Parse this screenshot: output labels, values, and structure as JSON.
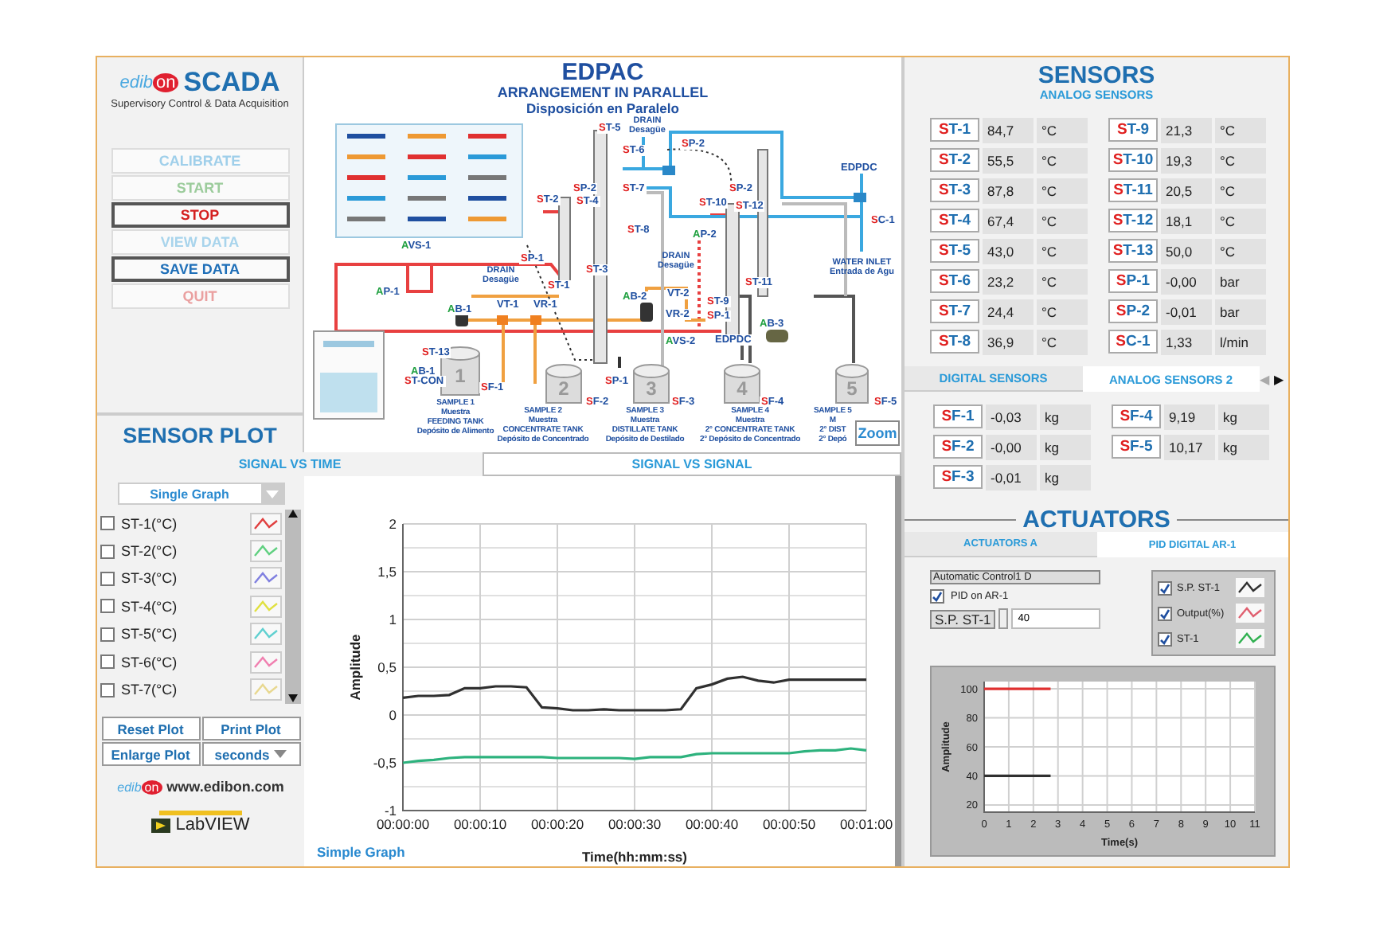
{
  "header": {
    "brand": "edibon",
    "product": "SCADA",
    "tagline": "Supervisory Control & Data Acquisition"
  },
  "control_buttons": [
    {
      "label": "CALIBRATE",
      "disabled": true,
      "color": "#9fcfea"
    },
    {
      "label": "START",
      "disabled": true,
      "color": "#9ccc9c"
    },
    {
      "label": "STOP",
      "disabled": false,
      "color": "#d42020"
    },
    {
      "label": "VIEW DATA",
      "disabled": true,
      "color": "#a8d4ec"
    },
    {
      "label": "SAVE DATA",
      "disabled": false,
      "color": "#1f6fb8"
    },
    {
      "label": "QUIT",
      "disabled": true,
      "color": "#eaa0a0"
    }
  ],
  "diagram": {
    "title": "EDPAC",
    "subtitle": "ARRANGEMENT IN PARALLEL",
    "subtitle_es": "Disposición en Paralelo",
    "tags": [
      {
        "text": "ST-5",
        "kind": "sensor"
      },
      {
        "text": "ST-6",
        "kind": "sensor"
      },
      {
        "text": "SP-2",
        "kind": "sensor"
      },
      {
        "text": "SP-2",
        "kind": "sensor"
      },
      {
        "text": "ST-7",
        "kind": "sensor"
      },
      {
        "text": "ST-2",
        "kind": "sensor"
      },
      {
        "text": "ST-4",
        "kind": "sensor"
      },
      {
        "text": "SP-2",
        "kind": "sensor"
      },
      {
        "text": "ST-10",
        "kind": "sensor"
      },
      {
        "text": "ST-12",
        "kind": "sensor"
      },
      {
        "text": "EDPDC",
        "kind": "label"
      },
      {
        "text": "SC-1",
        "kind": "sensor"
      },
      {
        "text": "ST-8",
        "kind": "sensor"
      },
      {
        "text": "AP-2",
        "kind": "actuator"
      },
      {
        "text": "AVS-1",
        "kind": "actuator"
      },
      {
        "text": "SP-1",
        "kind": "sensor"
      },
      {
        "text": "ST-3",
        "kind": "sensor"
      },
      {
        "text": "ST-11",
        "kind": "sensor"
      },
      {
        "text": "AP-1",
        "kind": "actuator"
      },
      {
        "text": "ST-1",
        "kind": "sensor"
      },
      {
        "text": "AB-2",
        "kind": "actuator"
      },
      {
        "text": "VT-2",
        "kind": "label"
      },
      {
        "text": "VT-1",
        "kind": "label"
      },
      {
        "text": "VR-1",
        "kind": "label"
      },
      {
        "text": "ST-9",
        "kind": "sensor"
      },
      {
        "text": "AB-1",
        "kind": "actuator"
      },
      {
        "text": "VR-2",
        "kind": "label"
      },
      {
        "text": "SP-1",
        "kind": "sensor"
      },
      {
        "text": "AB-3",
        "kind": "actuator"
      },
      {
        "text": "AVS-2",
        "kind": "actuator"
      },
      {
        "text": "EDPDC",
        "kind": "label"
      },
      {
        "text": "ST-13",
        "kind": "sensor"
      },
      {
        "text": "AB-1",
        "kind": "actuator"
      },
      {
        "text": "ST-CON",
        "kind": "sensor"
      },
      {
        "text": "SF-1",
        "kind": "sensor"
      },
      {
        "text": "SP-1",
        "kind": "sensor"
      },
      {
        "text": "SF-2",
        "kind": "sensor"
      },
      {
        "text": "SF-3",
        "kind": "sensor"
      },
      {
        "text": "SF-4",
        "kind": "sensor"
      },
      {
        "text": "SF-5",
        "kind": "sensor"
      }
    ],
    "notes": [
      {
        "lines": [
          "DRAIN",
          "Desagüe"
        ]
      },
      {
        "lines": [
          "DRAIN",
          "Desagüe"
        ]
      },
      {
        "lines": [
          "DRAIN",
          "Desagüe"
        ]
      },
      {
        "lines": [
          "WATER INLET",
          "Entrada de Agu"
        ]
      }
    ],
    "tanks": [
      {
        "number": "1",
        "caption": [
          "SAMPLE 1",
          "Muestra",
          "FEEDING TANK",
          "Depósito de Alimento"
        ]
      },
      {
        "number": "2",
        "caption": [
          "SAMPLE 2",
          "Muestra",
          "CONCENTRATE TANK",
          "Depósito de Concentrado"
        ]
      },
      {
        "number": "3",
        "caption": [
          "SAMPLE 3",
          "Muestra",
          "DISTILLATE TANK",
          "Depósito de Destilado"
        ]
      },
      {
        "number": "4",
        "caption": [
          "SAMPLE 4",
          "Muestra",
          "2° CONCENTRATE TANK",
          "2° Depósito de Concentrado"
        ]
      },
      {
        "number": "5",
        "caption": [
          "SAMPLE 5",
          "M",
          "2° DIST",
          "2° Depó"
        ]
      }
    ],
    "zoom_button": "Zoom"
  },
  "sensor_plot": {
    "title": "SENSOR PLOT",
    "tabs": [
      {
        "label": "SIGNAL VS TIME",
        "selected": true
      },
      {
        "label": "SIGNAL VS SIGNAL",
        "selected": false
      }
    ],
    "graph_mode": "Single Graph",
    "signals": [
      {
        "label": "ST-1(°C)",
        "checked": false,
        "color": "#e04040"
      },
      {
        "label": "ST-2(°C)",
        "checked": false,
        "color": "#60d080"
      },
      {
        "label": "ST-3(°C)",
        "checked": false,
        "color": "#8080e0"
      },
      {
        "label": "ST-4(°C)",
        "checked": false,
        "color": "#e0e040"
      },
      {
        "label": "ST-5(°C)",
        "checked": false,
        "color": "#60d0d0"
      },
      {
        "label": "ST-6(°C)",
        "checked": false,
        "color": "#f080b0"
      },
      {
        "label": "ST-7(°C)",
        "checked": false,
        "color": "#e8d890"
      }
    ],
    "buttons": [
      "Reset Plot",
      "Print Plot",
      "Enlarge Plot"
    ],
    "time_unit": "seconds",
    "graph_caption": "Simple Graph",
    "chart_data": {
      "type": "line",
      "grid": true,
      "xlabel": "Time(hh:mm:ss)",
      "ylabel": "Amplitude",
      "xlim": [
        0,
        60
      ],
      "ylim": [
        -1,
        2
      ],
      "xticks": [
        {
          "value": 0,
          "label": "00:00:00"
        },
        {
          "value": 10,
          "label": "00:00:10"
        },
        {
          "value": 20,
          "label": "00:00:20"
        },
        {
          "value": 30,
          "label": "00:00:30"
        },
        {
          "value": 40,
          "label": "00:00:40"
        },
        {
          "value": 50,
          "label": "00:00:50"
        },
        {
          "value": 60,
          "label": "00:01:00"
        }
      ],
      "yticks": [
        {
          "value": 2,
          "label": "2"
        },
        {
          "value": 1.5,
          "label": "1,5"
        },
        {
          "value": 1,
          "label": "1"
        },
        {
          "value": 0.5,
          "label": "0,5"
        },
        {
          "value": 0,
          "label": "0"
        },
        {
          "value": -0.5,
          "label": "-0,5"
        },
        {
          "value": -1,
          "label": "-1"
        }
      ],
      "x": [
        0,
        2,
        4,
        6,
        8,
        10,
        12,
        14,
        16,
        18,
        20,
        22,
        24,
        26,
        28,
        30,
        32,
        34,
        36,
        38,
        40,
        42,
        44,
        46,
        48,
        50,
        52,
        54,
        56,
        58,
        60
      ],
      "series": [
        {
          "color": "#303030",
          "values": [
            0.18,
            0.2,
            0.2,
            0.21,
            0.28,
            0.28,
            0.3,
            0.3,
            0.29,
            0.08,
            0.07,
            0.05,
            0.05,
            0.06,
            0.05,
            0.05,
            0.05,
            0.05,
            0.06,
            0.28,
            0.32,
            0.38,
            0.4,
            0.36,
            0.34,
            0.37,
            0.37,
            0.37,
            0.37,
            0.37,
            0.37
          ]
        },
        {
          "color": "#2db27d",
          "values": [
            -0.5,
            -0.48,
            -0.47,
            -0.45,
            -0.44,
            -0.44,
            -0.44,
            -0.44,
            -0.44,
            -0.44,
            -0.45,
            -0.45,
            -0.45,
            -0.45,
            -0.45,
            -0.46,
            -0.44,
            -0.44,
            -0.44,
            -0.41,
            -0.4,
            -0.4,
            -0.4,
            -0.4,
            -0.4,
            -0.4,
            -0.38,
            -0.37,
            -0.37,
            -0.35,
            -0.37
          ]
        }
      ]
    }
  },
  "footer": {
    "brand": "edibon",
    "url": "www.edibon.com",
    "labview": "LabVIEW"
  },
  "sensors": {
    "title": "SENSORS",
    "subtitle": "ANALOG SENSORS",
    "analog": [
      {
        "tag": "ST-1",
        "value": "84,7",
        "unit": "°C"
      },
      {
        "tag": "ST-2",
        "value": "55,5",
        "unit": "°C"
      },
      {
        "tag": "ST-3",
        "value": "87,8",
        "unit": "°C"
      },
      {
        "tag": "ST-4",
        "value": "67,4",
        "unit": "°C"
      },
      {
        "tag": "ST-5",
        "value": "43,0",
        "unit": "°C"
      },
      {
        "tag": "ST-6",
        "value": "23,2",
        "unit": "°C"
      },
      {
        "tag": "ST-7",
        "value": "24,4",
        "unit": "°C"
      },
      {
        "tag": "ST-8",
        "value": "36,9",
        "unit": "°C"
      },
      {
        "tag": "ST-9",
        "value": "21,3",
        "unit": "°C"
      },
      {
        "tag": "ST-10",
        "value": "19,3",
        "unit": "°C"
      },
      {
        "tag": "ST-11",
        "value": "20,5",
        "unit": "°C"
      },
      {
        "tag": "ST-12",
        "value": "18,1",
        "unit": "°C"
      },
      {
        "tag": "ST-13",
        "value": "50,0",
        "unit": "°C"
      },
      {
        "tag": "SP-1",
        "value": "-0,00",
        "unit": "bar"
      },
      {
        "tag": "SP-2",
        "value": "-0,01",
        "unit": "bar"
      },
      {
        "tag": "SC-1",
        "value": "1,33",
        "unit": "l/min"
      }
    ],
    "tabs": [
      {
        "label": "DIGITAL SENSORS",
        "selected": false
      },
      {
        "label": "ANALOG SENSORS 2",
        "selected": true
      }
    ],
    "tab_arrows": [
      {
        "glyph": "◀",
        "disabled": true
      },
      {
        "glyph": "▶",
        "disabled": false
      }
    ],
    "analog_2": [
      {
        "tag": "SF-1",
        "value": "-0,03",
        "unit": "kg"
      },
      {
        "tag": "SF-2",
        "value": "-0,00",
        "unit": "kg"
      },
      {
        "tag": "SF-3",
        "value": "-0,01",
        "unit": "kg"
      },
      {
        "tag": "SF-4",
        "value": "9,19",
        "unit": "kg"
      },
      {
        "tag": "SF-5",
        "value": "10,17",
        "unit": "kg"
      }
    ]
  },
  "actuators": {
    "title": "ACTUATORS",
    "tabs": [
      {
        "label": "ACTUATORS A",
        "selected": false
      },
      {
        "label": "PID DIGITAL AR-1",
        "selected": true
      }
    ],
    "control_group": "Automatic Control1 D",
    "pid_checkbox": {
      "label": "PID on AR-1",
      "checked": true
    },
    "setpoint": {
      "label": "S.P. ST-1",
      "value": "40"
    },
    "legend": [
      {
        "label": "S.P. ST-1",
        "checked": true,
        "color": "#303030"
      },
      {
        "label": "Output(%)",
        "checked": true,
        "color": "#e06070"
      },
      {
        "label": "ST-1",
        "checked": true,
        "color": "#30b050"
      }
    ],
    "chart_data": {
      "type": "line",
      "grid": true,
      "xlabel": "Time(s)",
      "ylabel": "Amplitude",
      "xlim": [
        0,
        11
      ],
      "ylim": [
        15,
        105
      ],
      "xticks": [
        {
          "value": 0,
          "label": "0"
        },
        {
          "value": 1,
          "label": "1"
        },
        {
          "value": 2,
          "label": "2"
        },
        {
          "value": 3,
          "label": "3"
        },
        {
          "value": 4,
          "label": "4"
        },
        {
          "value": 5,
          "label": "5"
        },
        {
          "value": 6,
          "label": "6"
        },
        {
          "value": 7,
          "label": "7"
        },
        {
          "value": 8,
          "label": "8"
        },
        {
          "value": 9,
          "label": "9"
        },
        {
          "value": 10,
          "label": "10"
        },
        {
          "value": 11,
          "label": "11"
        }
      ],
      "yticks": [
        {
          "value": 20,
          "label": "20"
        },
        {
          "value": 40,
          "label": "40"
        },
        {
          "value": 60,
          "label": "60"
        },
        {
          "value": 80,
          "label": "80"
        },
        {
          "value": 100,
          "label": "100"
        }
      ],
      "x": [
        0,
        2.7
      ],
      "series": [
        {
          "color": "#e03030",
          "values": [
            100,
            100
          ]
        },
        {
          "color": "#303030",
          "values": [
            40,
            40
          ]
        }
      ]
    }
  }
}
